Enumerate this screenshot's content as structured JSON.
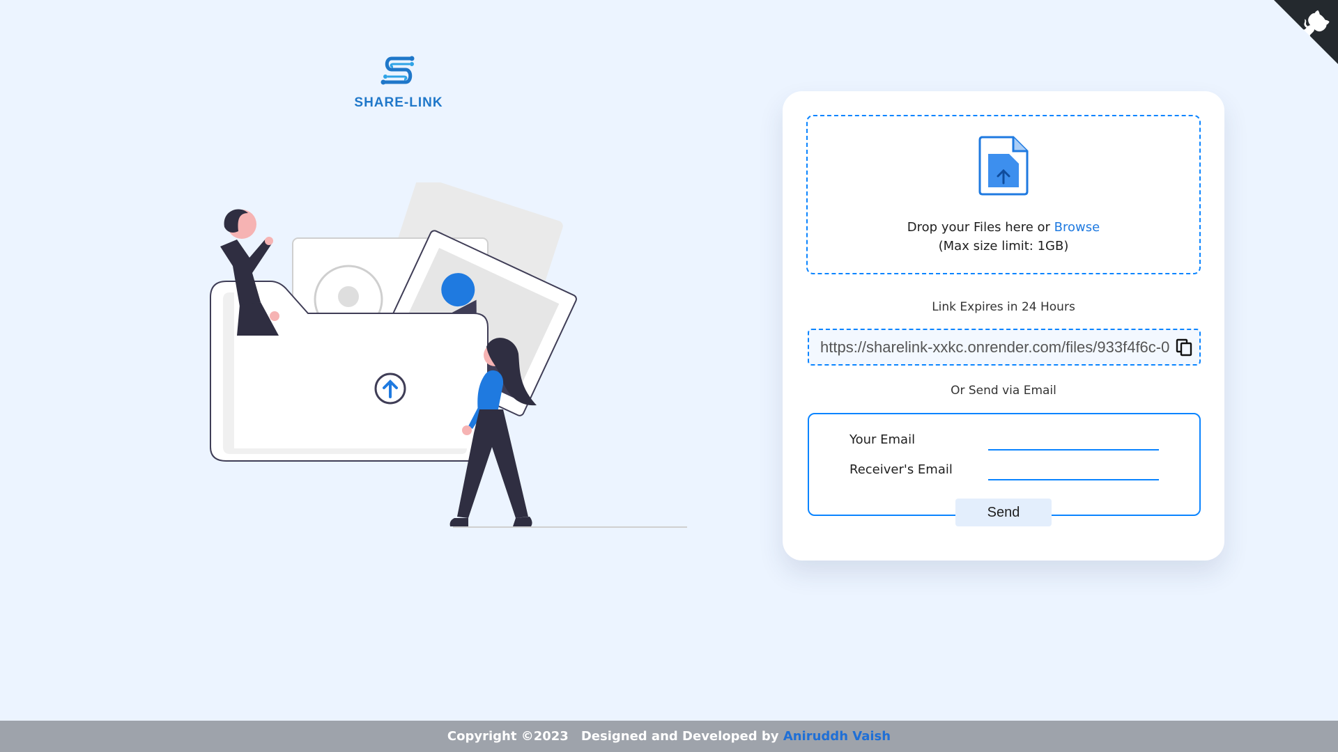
{
  "app": {
    "logo_text": "SHARE-LINK"
  },
  "upload": {
    "drop_text": "Drop your Files here or ",
    "browse_label": "Browse",
    "size_limit": "(Max size limit: 1GB)"
  },
  "share": {
    "expiry_text": "Link Expires in 24 Hours",
    "link_value": "https://sharelink-xxkc.onrender.com/files/933f4f6c-0",
    "or_email_text": "Or Send via Email"
  },
  "email_form": {
    "sender_label": "Your Email",
    "sender_value": "",
    "receiver_label": "Receiver's Email",
    "receiver_value": "",
    "send_label": "Send"
  },
  "footer": {
    "copyright": "Copyright ©2023",
    "designed_by": "Designed and Developed by ",
    "author": "Aniruddh Vaish"
  },
  "colors": {
    "accent": "#0a84ff",
    "page_background": "#ecf4ff",
    "footer_background": "#9ea3ab",
    "link": "#1f7ae0"
  },
  "icons": {
    "corner": "github-octocat-icon",
    "upload_file": "file-upload-icon",
    "copy": "copy-icon",
    "logo": "share-link-logo-icon"
  }
}
